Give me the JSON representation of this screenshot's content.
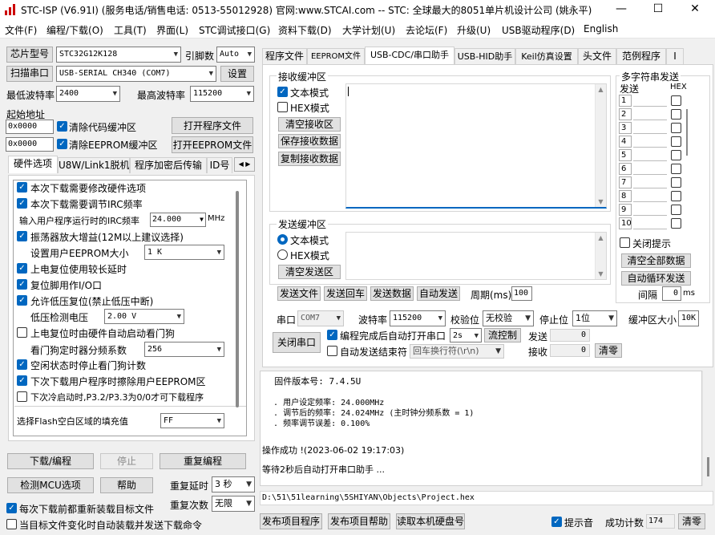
{
  "window": {
    "title": "STC-ISP (V6.91I) (服务电话/销售电话: 0513-55012928) 官网:www.STCAI.com  -- STC: 全球最大的8051单片机设计公司 (姚永平)",
    "min": "—",
    "max": "☐",
    "close": "✕"
  },
  "menu": [
    "文件(F)",
    "编程/下载(O)",
    "工具(T)",
    "界面(L)",
    "STC调试接口(G)",
    "资料下载(D)",
    "大学计划(U)",
    "去论坛(F)",
    "升级(U)",
    "USB驱动程序(D)",
    "English"
  ],
  "left": {
    "chip_label": "芯片型号",
    "chip_value": "STC32G12K128",
    "pin_label": "引脚数",
    "pin_value": "Auto",
    "scan_label": "扫描串口",
    "port_value": "USB-SERIAL CH340 (COM7)",
    "settings_label": "设置",
    "min_baud_label": "最低波特率",
    "min_baud": "2400",
    "max_baud_label": "最高波特率",
    "max_baud": "115200",
    "start_addr_label": "起始地址",
    "addr1": "0x0000",
    "clear_code": "清除代码缓冲区",
    "open_prog": "打开程序文件",
    "addr2": "0x0000",
    "clear_eeprom": "清除EEPROM缓冲区",
    "open_eeprom": "打开EEPROM文件",
    "tabs": [
      "硬件选项",
      "U8W/Link1脱机",
      "程序加密后传输",
      "ID号"
    ],
    "hw": {
      "o1": "本次下载需要修改硬件选项",
      "o2": "本次下载需要调节IRC频率",
      "irc_label": "输入用户程序运行时的IRC频率",
      "irc_value": "24.000",
      "irc_unit": "MHz",
      "o3": "振荡器放大增益(12M以上建议选择)",
      "eeprom_label": "设置用户EEPROM大小",
      "eeprom_value": "1  K",
      "o4": "上电复位使用较长延时",
      "o5": "复位脚用作I/O口",
      "o6": "允许低压复位(禁止低压中断)",
      "lvd_label": "低压检测电压",
      "lvd_value": "2.00 V",
      "o7": "上电复位时由硬件自动启动看门狗",
      "wdt_label": "看门狗定时器分频系数",
      "wdt_value": "256",
      "o8": "空闲状态时停止看门狗计数",
      "o9": "下次下载用户程序时擦除用户EEPROM区",
      "o10": "下次冷启动时,P3.2/P3.3为0/0才可下载程序",
      "fill_label": "选择Flash空白区域的填充值",
      "fill_value": "FF"
    },
    "download": "下载/编程",
    "stop": "停止",
    "reprog": "重复编程",
    "detect": "检测MCU选项",
    "help": "帮助",
    "delay_label": "重复延时",
    "delay_value": "3 秒",
    "times_label": "重复次数",
    "times_value": "无限",
    "reload": "每次下载前都重新装载目标文件",
    "autoload": "当目标文件变化时自动装载并发送下载命令"
  },
  "right": {
    "tabs": [
      "程序文件",
      "EEPROM文件",
      "USB-CDC/串口助手",
      "USB-HID助手",
      "Keil仿真设置",
      "头文件",
      "范例程序",
      "I"
    ],
    "recv_title": "接收缓冲区",
    "text_mode": "文本模式",
    "hex_mode": "HEX模式",
    "clear_recv": "清空接收区",
    "save_recv": "保存接收数据",
    "copy_recv": "复制接收数据",
    "send_title": "发送缓冲区",
    "send_text": "文本模式",
    "send_hex": "HEX模式",
    "clear_send": "清空发送区",
    "send_file": "发送文件",
    "send_return": "发送回车",
    "send_data": "发送数据",
    "auto_send": "自动发送",
    "period_label": "周期(ms)",
    "period": "100",
    "multi_title": "多字符串发送",
    "multi_send": "发送",
    "multi_hex": "HEX",
    "multi_nums": [
      "1",
      "2",
      "3",
      "4",
      "5",
      "6",
      "7",
      "8",
      "9",
      "10"
    ],
    "close_tip": "关闭提示",
    "clear_all": "清空全部数据",
    "auto_loop": "自动循环发送",
    "interval_label": "间隔",
    "interval": "0",
    "interval_unit": "ms",
    "port_label": "串口",
    "port_value": "COM7",
    "baud_label": "波特率",
    "baud": "115200",
    "parity_label": "校验位",
    "parity": "无校验",
    "stop_label": "停止位",
    "stop": "1位",
    "buf_label": "缓冲区大小",
    "buf": "10K",
    "close_port": "关闭串口",
    "auto_open": "编程完成后自动打开串口",
    "auto_open_val": "2s",
    "flow": "流控制",
    "auto_end": "自动发送结束符",
    "end_val": "回车换行符(\\r\\n)",
    "tx_label": "发送",
    "tx": "0",
    "rx_label": "接收",
    "rx": "0",
    "clear_cnt": "清零"
  },
  "log": {
    "fw": "  固件版本号: 7.4.5U",
    "l1": "  . 用户设定频率: 24.000MHz",
    "l2": "  . 调节后的频率: 24.024MHz (主时钟分频系数 = 1)",
    "l3": "  . 频率调节误差: 0.100%",
    "ok": "操作成功 !(2023-06-02 19:17:03)",
    "wait": "等待2秒后自动打开串口助手 ..."
  },
  "path": "D:\\51\\51learning\\5SHIYAN\\Objects\\Project.hex",
  "bottom": {
    "publish": "发布项目程序",
    "publish_help": "发布项目帮助",
    "read_disk": "读取本机硬盘号",
    "sound": "提示音",
    "count_label": "成功计数",
    "count": "174",
    "clear": "清零"
  }
}
